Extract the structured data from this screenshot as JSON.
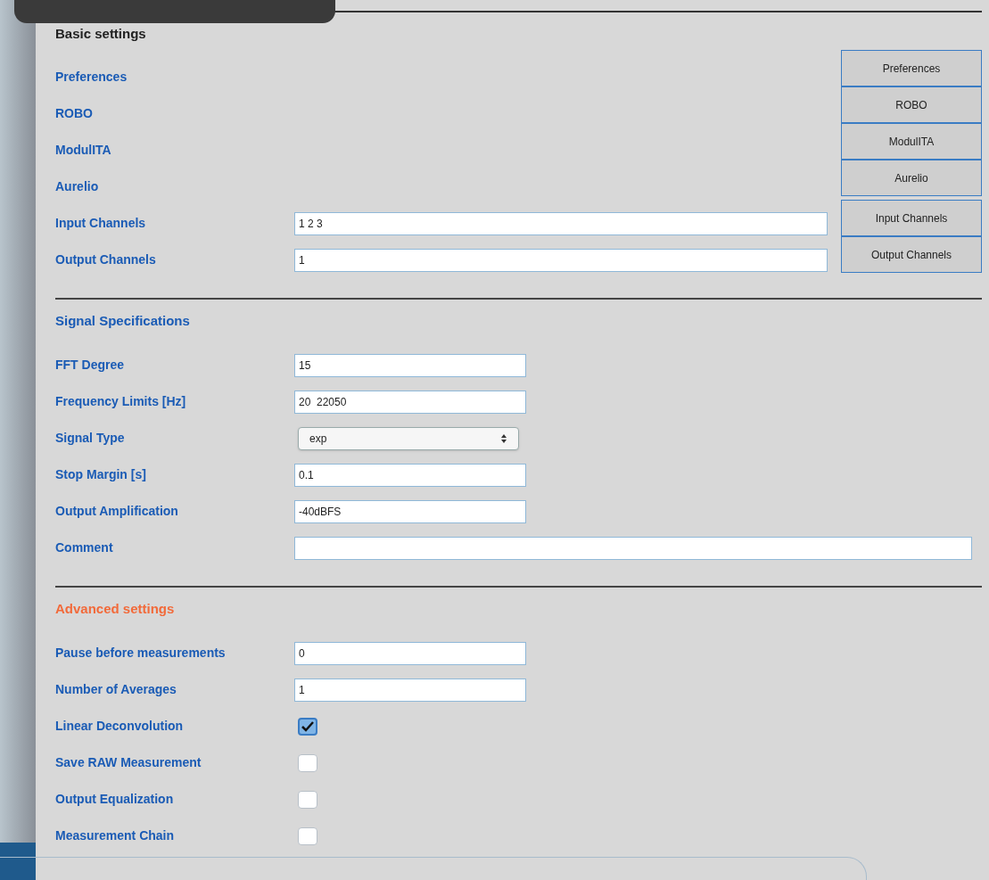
{
  "sections": [
    {
      "title": "Basic settings",
      "color": "#222222",
      "rows": [
        {
          "label": "Preferences",
          "kind": "label"
        },
        {
          "label": "ROBO",
          "kind": "label"
        },
        {
          "label": "ModulITA",
          "kind": "label"
        },
        {
          "label": "Aurelio",
          "kind": "label"
        },
        {
          "label": "Input Channels",
          "kind": "wide-text",
          "value": "1 2 3"
        },
        {
          "label": "Output Channels",
          "kind": "wide-text",
          "value": "1"
        }
      ],
      "side_buttons": [
        "Preferences",
        "ROBO",
        "ModulITA",
        "Aurelio",
        "Input Channels",
        "Output Channels"
      ]
    },
    {
      "title": "Signal Specifications",
      "color": "#1a5bb5",
      "rows": [
        {
          "label": "FFT Degree",
          "kind": "text",
          "value": "15"
        },
        {
          "label": "Frequency Limits [Hz]",
          "kind": "text",
          "value": "20  22050"
        },
        {
          "label": "Signal Type",
          "kind": "select",
          "value": "exp"
        },
        {
          "label": "Stop Margin [s]",
          "kind": "text",
          "value": "0.1"
        },
        {
          "label": "Output Amplification",
          "kind": "text",
          "value": "-40dBFS"
        },
        {
          "label": "Comment",
          "kind": "full-text"
        }
      ]
    },
    {
      "title": "Advanced settings",
      "color": "#f26a3a",
      "rows": [
        {
          "label": "Pause before measurements",
          "kind": "text",
          "value": "0"
        },
        {
          "label": "Number of Averages",
          "kind": "text",
          "value": "1"
        },
        {
          "label": "Linear Deconvolution",
          "kind": "checkbox",
          "checked": true
        },
        {
          "label": "Save RAW Measurement",
          "kind": "checkbox",
          "checked": false
        },
        {
          "label": "Output Equalization",
          "kind": "checkbox",
          "checked": false
        },
        {
          "label": "Measurement Chain",
          "kind": "checkbox",
          "checked": false
        }
      ]
    }
  ]
}
